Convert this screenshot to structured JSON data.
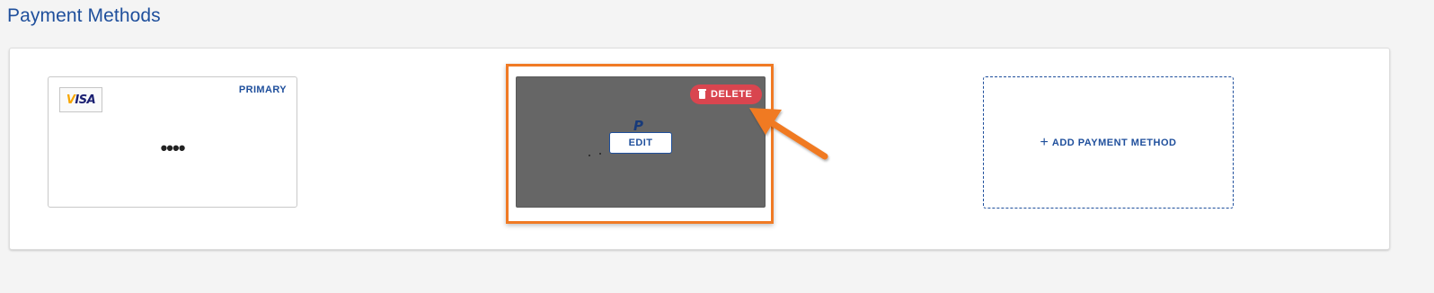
{
  "page": {
    "title": "Payment Methods"
  },
  "payment_methods": [
    {
      "brand": "VISA",
      "brand_icon": "visa-logo",
      "badge": "PRIMARY",
      "masked_number": "••••"
    },
    {
      "brand": "PayPal",
      "brand_icon": "paypal-logo",
      "logo_glyph": "P",
      "delete_label": "DELETE",
      "delete_icon": "trash-icon",
      "edit_label": "EDIT"
    }
  ],
  "add_card": {
    "icon": "plus-icon",
    "icon_glyph": "+",
    "label": "ADD PAYMENT METHOD"
  },
  "colors": {
    "title_blue": "#1f4f9c",
    "highlight_orange": "#f07a24",
    "delete_red": "#d9454f",
    "card_overlay_gray": "#666666",
    "page_background": "#f4f4f4"
  }
}
